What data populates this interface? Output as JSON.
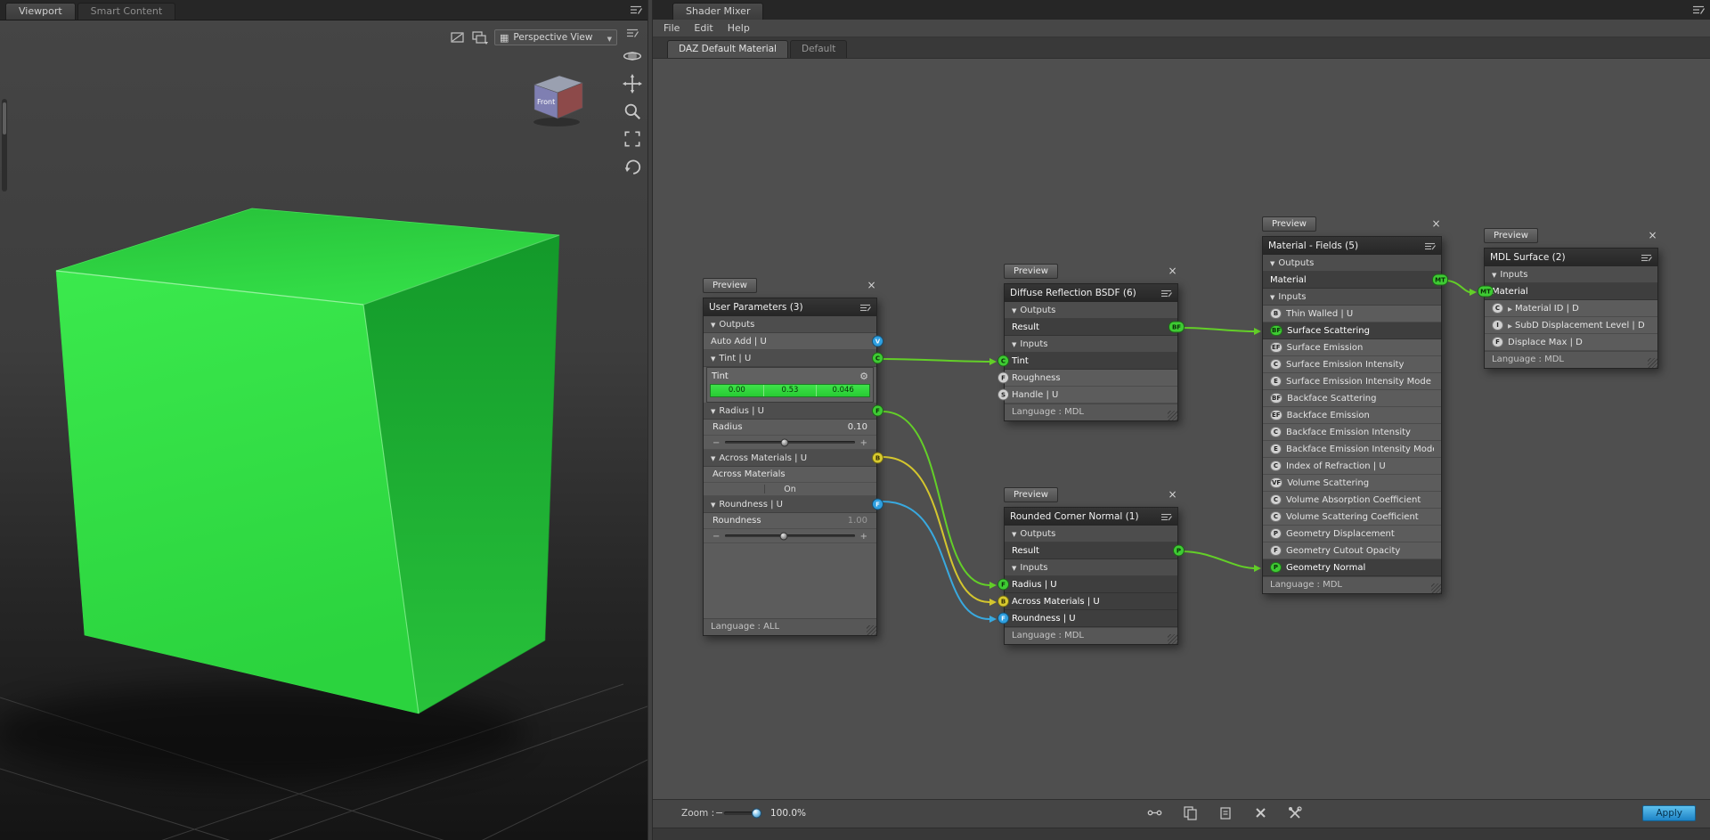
{
  "left_panel": {
    "tabs": [
      "Viewport",
      "Smart Content"
    ],
    "toolbar": {
      "camera_selector": "Perspective View"
    },
    "nav_cube": {
      "front_label": "Front"
    }
  },
  "right_panel": {
    "panel_tab": "Shader Mixer",
    "menus": [
      "File",
      "Edit",
      "Help"
    ],
    "material_tabs": [
      "DAZ Default Material",
      "Default"
    ],
    "footer": {
      "zoom_label": "Zoom :",
      "zoom_minus": "−",
      "zoom_value": "100.0%",
      "apply": "Apply"
    }
  },
  "nodes": {
    "preview_label": "Preview",
    "user_parameters": {
      "title": "User Parameters (3)",
      "outputs_section": "Outputs",
      "auto_add": "Auto Add  | U",
      "auto_add_socket": "V",
      "tint_section": "Tint  | U",
      "tint_socket": "C",
      "tint_label": "Tint",
      "tint_values": [
        "0.00",
        "0.53",
        "0.046"
      ],
      "radius_section": "Radius  | U",
      "radius_socket": "F",
      "radius_label": "Radius",
      "radius_value": "0.10",
      "across_section": "Across Materials  | U",
      "across_socket": "B",
      "across_label": "Across Materials",
      "across_value": "On",
      "roundness_section": "Roundness  | U",
      "roundness_socket": "F",
      "roundness_label": "Roundness",
      "roundness_value": "1.00",
      "language": "Language : ALL"
    },
    "diffuse": {
      "title": "Diffuse Reflection BSDF (6)",
      "language": "Language : MDL",
      "rows": [
        {
          "kind": "section",
          "label": "Outputs"
        },
        {
          "kind": "item",
          "label": "Result",
          "sel": true,
          "out": "BF",
          "socket": "green"
        },
        {
          "kind": "section",
          "label": "Inputs"
        },
        {
          "kind": "item",
          "label": "Tint",
          "sel": true,
          "in": "C",
          "socket": "green"
        },
        {
          "kind": "item",
          "label": "Roughness",
          "in": "F",
          "socket": "light"
        },
        {
          "kind": "item",
          "label": "Handle  | U",
          "in": "S",
          "socket": "light"
        }
      ]
    },
    "rounded": {
      "title": "Rounded Corner Normal (1)",
      "language": "Language : MDL",
      "rows": [
        {
          "kind": "section",
          "label": "Outputs"
        },
        {
          "kind": "item",
          "label": "Result",
          "sel": true,
          "out": "P",
          "socket": "green"
        },
        {
          "kind": "section",
          "label": "Inputs"
        },
        {
          "kind": "item",
          "label": "Radius  | U",
          "sel": true,
          "in": "F",
          "socket": "green"
        },
        {
          "kind": "item",
          "label": "Across Materials  | U",
          "sel": true,
          "in": "B",
          "socket": "yellow"
        },
        {
          "kind": "item",
          "label": "Roundness  | U",
          "sel": true,
          "in": "F",
          "socket": "blue"
        }
      ]
    },
    "material_fields": {
      "title": "Material - Fields (5)",
      "language": "Language : MDL",
      "rows": [
        {
          "kind": "section",
          "label": "Outputs"
        },
        {
          "kind": "item",
          "label": "Material",
          "sel": true,
          "out": "MT",
          "socket": "green"
        },
        {
          "kind": "section",
          "label": "Inputs"
        },
        {
          "kind": "item",
          "label": "Thin Walled  | U",
          "badge": "B"
        },
        {
          "kind": "item",
          "label": "Surface Scattering",
          "sel": true,
          "badge": "BF",
          "socket": "green"
        },
        {
          "kind": "item",
          "label": "Surface Emission",
          "badge": "EF"
        },
        {
          "kind": "item",
          "label": "Surface Emission Intensity",
          "badge": "C"
        },
        {
          "kind": "item",
          "label": "Surface Emission Intensity Mode  | U (",
          "badge": "E"
        },
        {
          "kind": "item",
          "label": "Backface Scattering",
          "badge": "BF"
        },
        {
          "kind": "item",
          "label": "Backface Emission",
          "badge": "EF"
        },
        {
          "kind": "item",
          "label": "Backface Emission Intensity",
          "badge": "C"
        },
        {
          "kind": "item",
          "label": "Backface Emission Intensity Mode  | U",
          "badge": "E"
        },
        {
          "kind": "item",
          "label": "Index of Refraction  | U",
          "badge": "C"
        },
        {
          "kind": "item",
          "label": "Volume Scattering",
          "badge": "VF"
        },
        {
          "kind": "item",
          "label": "Volume Absorption Coefficient",
          "badge": "C"
        },
        {
          "kind": "item",
          "label": "Volume Scattering Coefficient",
          "badge": "C"
        },
        {
          "kind": "item",
          "label": "Geometry Displacement",
          "badge": "P"
        },
        {
          "kind": "item",
          "label": "Geometry Cutout Opacity",
          "badge": "F"
        },
        {
          "kind": "item",
          "label": "Geometry Normal",
          "sel": true,
          "badge": "P",
          "socket": "green"
        }
      ]
    },
    "mdl_surface": {
      "title": "MDL Surface (2)",
      "language": "Language : MDL",
      "rows": [
        {
          "kind": "section",
          "label": "Inputs"
        },
        {
          "kind": "item",
          "label": "Material",
          "sel": true,
          "in": "MT",
          "socket": "green"
        },
        {
          "kind": "item",
          "label": "Material ID  | D",
          "badge": "C",
          "expand": true
        },
        {
          "kind": "item",
          "label": "SubD Displacement Level  | D",
          "badge": "I",
          "expand": true
        },
        {
          "kind": "item",
          "label": "Displace Max  | D",
          "badge": "F"
        }
      ]
    }
  }
}
